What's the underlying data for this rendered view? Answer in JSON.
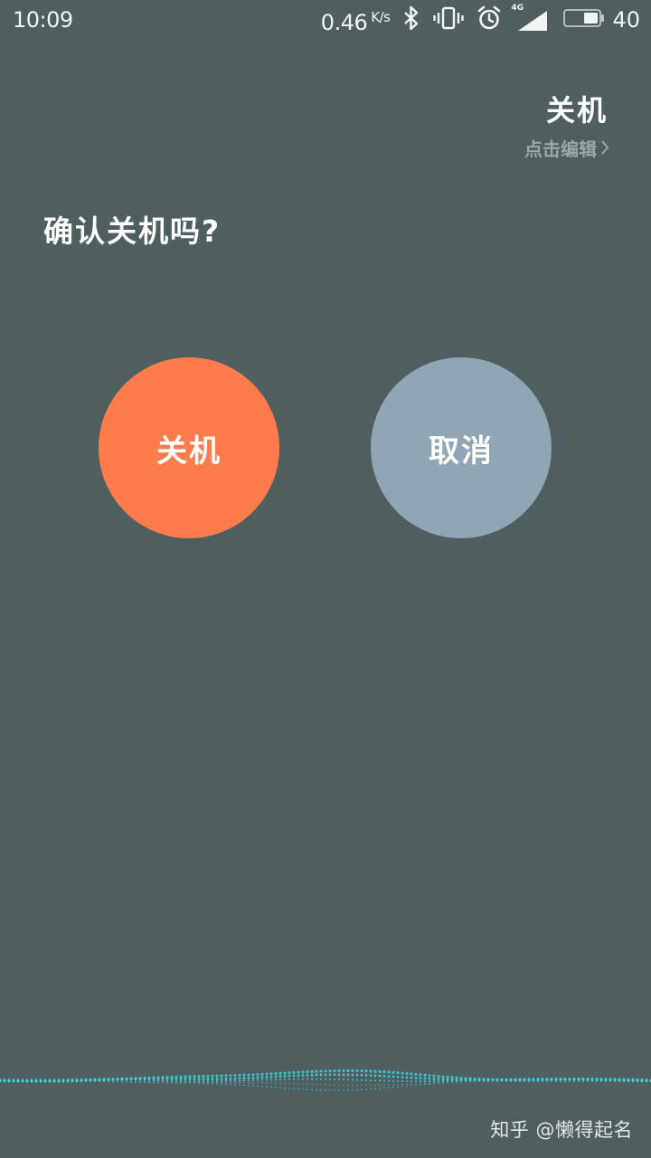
{
  "status_bar": {
    "time": "10:09",
    "net_speed": "0.46",
    "net_speed_unit": "K/s",
    "network_type": "4G",
    "battery_level": "40",
    "icons": [
      "bluetooth-icon",
      "vibrate-icon",
      "alarm-icon",
      "signal-icon",
      "battery-icon"
    ]
  },
  "header": {
    "title": "关机",
    "edit_label": "点击编辑",
    "edit_chevron": "chevron-right-icon"
  },
  "question": "确认关机吗?",
  "buttons": {
    "shutdown_label": "关机",
    "cancel_label": "取消"
  },
  "watermark": "知乎 @懒得起名",
  "colors": {
    "background": "#4f5f60",
    "shutdown": "#fe7c4b",
    "cancel": "#90a6b4",
    "wave": "#3fd6e6",
    "muted_text": "#9aa6a7"
  }
}
